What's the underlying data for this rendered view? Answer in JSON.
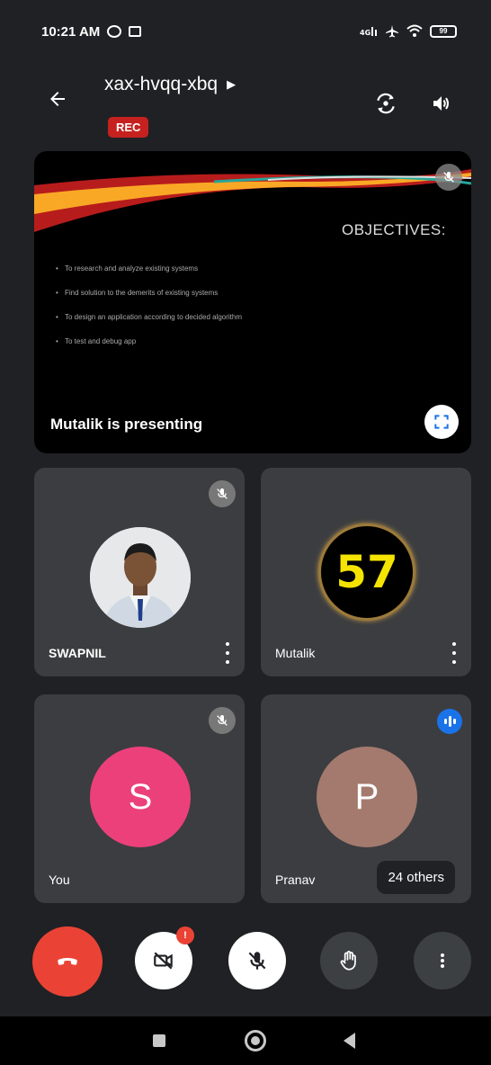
{
  "status_bar": {
    "time": "10:21 AM",
    "left_icons": [
      "whatsapp-icon",
      "cast-icon"
    ],
    "right_icons": [
      "volte-icon",
      "airplane-icon",
      "wifi-icon",
      "battery-icon"
    ],
    "battery": "99"
  },
  "header": {
    "meeting_code": "xax-hvqq-xbq",
    "rec_label": "REC",
    "icons": [
      "back-arrow-icon",
      "chevron-right-icon",
      "switch-camera-icon",
      "speaker-icon"
    ]
  },
  "presentation": {
    "slide_title": "OBJECTIVES:",
    "bullets": [
      "To research and analyze existing systems",
      "Find solution to the demerits of existing systems",
      "To design an application according to decided algorithm",
      "To test and debug app"
    ],
    "label": "Mutalik is presenting",
    "icons": [
      "mic-off-icon",
      "fullscreen-icon"
    ]
  },
  "participants": [
    {
      "name": "SWAPNIL",
      "avatar": "photo",
      "mic": "muted"
    },
    {
      "name": "Mutalik",
      "avatar_text": "57",
      "mic": "unmuted"
    },
    {
      "name": "You",
      "avatar_letter": "S",
      "avatar_color": "#ec407a",
      "mic": "muted"
    },
    {
      "name": "Pranav",
      "avatar_letter": "P",
      "avatar_color": "#a47a6e",
      "mic": "speaking"
    }
  ],
  "others_label": "24 others",
  "controls": {
    "camera_badge": "!",
    "icons": [
      "end-call-icon",
      "camera-off-icon",
      "mic-off-icon",
      "raise-hand-icon",
      "more-vert-icon"
    ],
    "colors": {
      "end_call": "#ea4335",
      "active": "#ffffff",
      "inactive": "#3c4043"
    }
  },
  "nav_bar": {
    "icons": [
      "recents-square-icon",
      "home-circle-icon",
      "back-triangle-icon"
    ]
  }
}
